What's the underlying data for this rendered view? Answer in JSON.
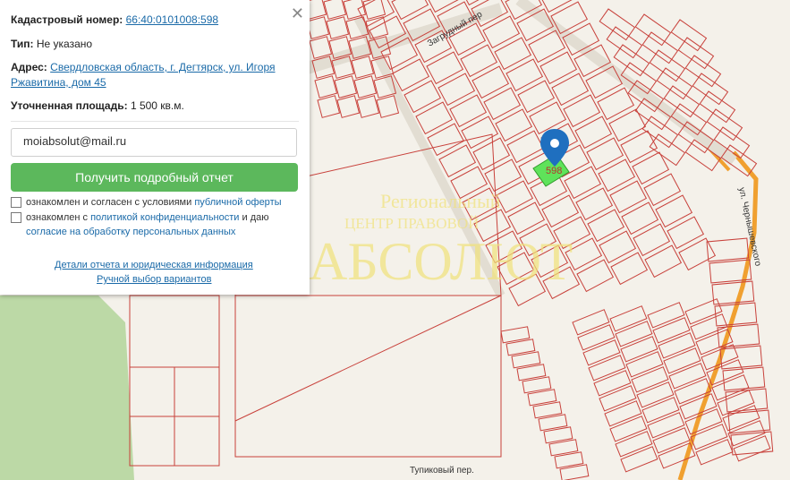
{
  "panel": {
    "cadastral_label": "Кадастровый номер:",
    "cadastral_value": "66:40:0101008:598",
    "type_label": "Тип:",
    "type_value": "Не указано",
    "address_label": "Адрес:",
    "address_line1": "Свердловская область, г. Дегтярск, ул. Игоря",
    "address_line2": "Ржавитина, дом 45",
    "area_label": "Уточненная площадь:",
    "area_value": "1 500 кв.м.",
    "email_value": "moiabsolut@mail.ru",
    "report_button": "Получить подробный отчет",
    "consent1_text": "ознакомлен и согласен с условиями",
    "consent1_link": "публичной оферты",
    "consent2_text": "ознакомлен с",
    "consent2_link": "политикой конфиденциальности",
    "consent2_text2": "и даю",
    "consent2_link2": "согласие на обработку персональных данных",
    "details_link": "Детали отчета и юридическая информация",
    "manual_link": "Ручной выбор вариантов",
    "close_glyph": "✕"
  },
  "watermark": {
    "line1": "Региональный",
    "line2": "ЦЕНТР ПРАВОВОЙ",
    "big": "АБСОЛЮТ"
  },
  "map": {
    "streets": [
      "Загрудный пер",
      "ул. Чернышевского",
      "Тупиковый пер.",
      "ул."
    ],
    "selected_plot": "598",
    "colors": {
      "plot_line": "#c8413b",
      "selected_fill": "#5fe35a",
      "marker": "#1f6fbf",
      "road": "#f0a030",
      "green": "#bcd9a6"
    }
  }
}
